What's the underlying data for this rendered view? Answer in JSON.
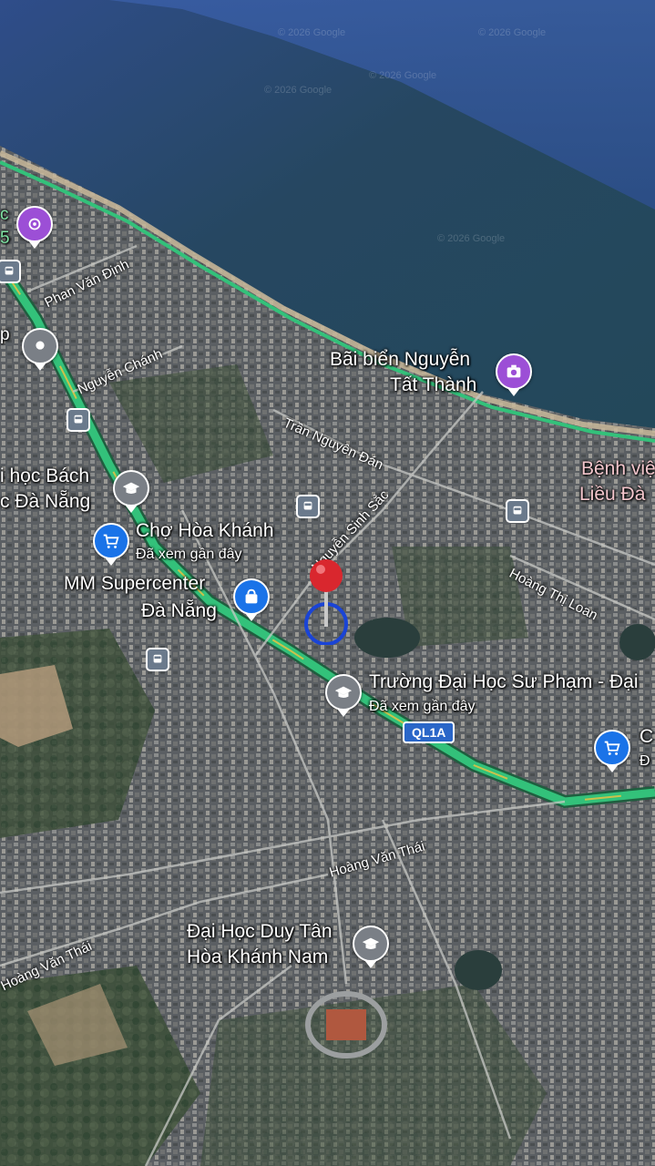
{
  "watermarks": [
    "© 2026 Google",
    "© 2026 Google",
    "© 2026 Google",
    "© 2026 Google",
    "© 2026 Google"
  ],
  "places": {
    "beach": {
      "line1": "Bãi biển Nguyễn",
      "line2": "Tất Thành"
    },
    "hospital": {
      "line1": "Bệnh việ",
      "line2": "Liều Đà"
    },
    "university_bk": {
      "line1": "i học Bách",
      "line2": "c Đà Nẵng"
    },
    "cho_hoa_khanh": {
      "title": "Chợ Hòa Khánh",
      "note": "Đã xem gần đây"
    },
    "mm_supercenter": {
      "line1": "MM Supercenter",
      "line2": "Đà Nẵng"
    },
    "su_pham": {
      "title": "Trường Đại Học Sư Phạm - Đại",
      "note": "Đã xem gần đây"
    },
    "duy_tan": {
      "line1": "Đại Học Duy Tân",
      "line2": "Hòa Khánh Nam"
    },
    "left_edge_c": "c",
    "left_edge_5": "5",
    "left_edge_p": "p",
    "right_edge_c": "C",
    "right_edge_d": "Đ"
  },
  "roads": {
    "phan_van_dinh": "Phan Văn Định",
    "nguyen_chanh": "Nguyễn Chánh",
    "tran_nguyen_dan": "Trần Nguyên Đán",
    "nguyen_sinh_sac": "Nguyễn Sinh Sắc",
    "hoang_thi_loan": "Hoàng Thị Loan",
    "hoang_van_thai_1": "Hoàng Văn Thái",
    "hoang_van_thai_2": "Hoàng Văn Thái"
  },
  "highway_shield": "QL1A",
  "icons": {
    "pin": "red-pushpin-icon",
    "location": "blue-location-ring-icon",
    "shopping": "shopping-cart-icon",
    "bag": "shopping-bag-icon",
    "school": "graduation-cap-icon",
    "camera": "camera-icon",
    "bus": "bus-stop-icon",
    "marker": "generic-place-icon"
  },
  "colors": {
    "sea": "#2c4a63",
    "highway": "#33c17a",
    "pin_red": "#d9272e",
    "school_grey": "#7a7f86",
    "shop_blue": "#1a73e8",
    "photo_purple": "#9c4fd6"
  }
}
